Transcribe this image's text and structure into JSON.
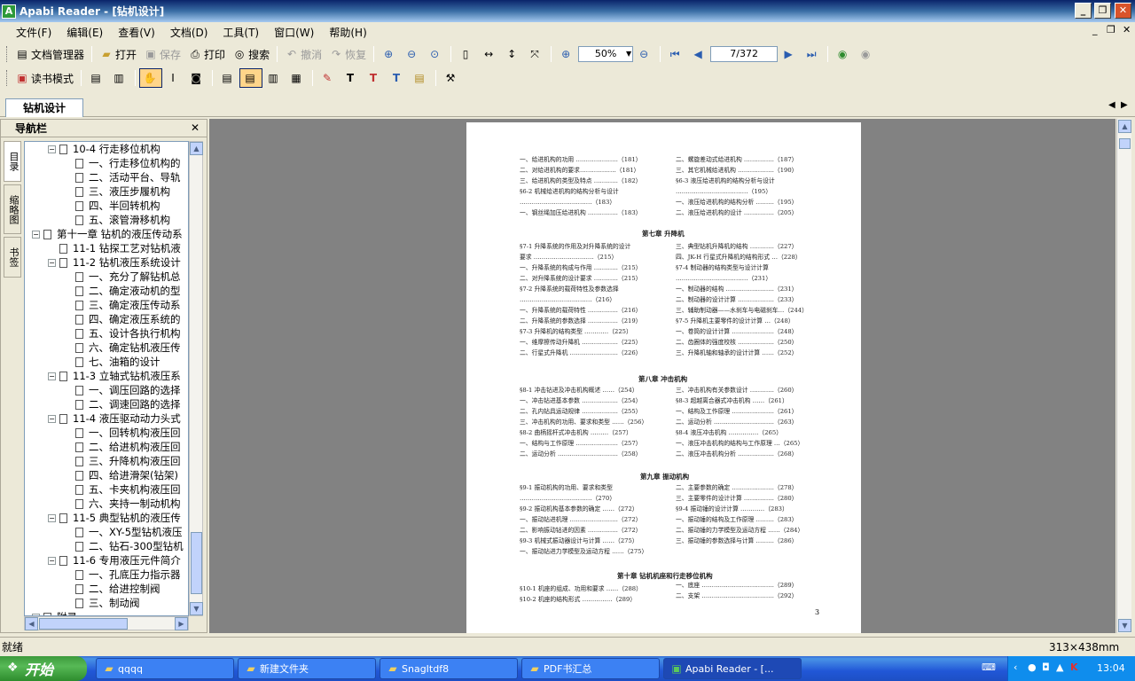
{
  "window": {
    "title": "Apabi Reader - [钻机设计]",
    "icon_text": "A"
  },
  "menus": [
    "文件(F)",
    "编辑(E)",
    "查看(V)",
    "文档(D)",
    "工具(T)",
    "窗口(W)",
    "帮助(H)"
  ],
  "toolbar1": {
    "doc_manager": "文档管理器",
    "open": "打开",
    "save": "保存",
    "print": "打印",
    "search": "搜索",
    "undo": "撤消",
    "redo": "恢复",
    "zoom_value": "50%",
    "page_value": "7/372"
  },
  "toolbar2": {
    "read_mode": "读书模式"
  },
  "doc_tab": "钻机设计",
  "nav": {
    "title": "导航栏",
    "tabs": [
      "目录",
      "缩略图",
      "书签"
    ],
    "tree": [
      {
        "text": "10-4 行走移位机构",
        "level": 2,
        "node": true
      },
      {
        "text": "一、行走移位机构的",
        "level": 3
      },
      {
        "text": "二、活动平台、导轨",
        "level": 3
      },
      {
        "text": "三、液压步履机构",
        "level": 3
      },
      {
        "text": "四、半回转机构",
        "level": 3
      },
      {
        "text": "五、滚管滑移机构",
        "level": 3
      },
      {
        "text": "第十一章 钻机的液压传动系",
        "level": 1,
        "node": true
      },
      {
        "text": "11-1 钻探工艺对钻机液",
        "level": 2
      },
      {
        "text": "11-2 钻机液压系统设计",
        "level": 2,
        "node": true
      },
      {
        "text": "一、充分了解钻机总",
        "level": 3
      },
      {
        "text": "二、确定液动机的型",
        "level": 3
      },
      {
        "text": "三、确定液压传动系",
        "level": 3
      },
      {
        "text": "四、确定液压系统的",
        "level": 3
      },
      {
        "text": "五、设计各执行机构",
        "level": 3
      },
      {
        "text": "六、确定钻机液压传",
        "level": 3
      },
      {
        "text": "七、油箱的设计",
        "level": 3
      },
      {
        "text": "11-3 立轴式钻机液压系",
        "level": 2,
        "node": true
      },
      {
        "text": "一、调压回路的选择",
        "level": 3
      },
      {
        "text": "二、调速回路的选择",
        "level": 3
      },
      {
        "text": "11-4 液压驱动动力头式",
        "level": 2,
        "node": true
      },
      {
        "text": "一、回转机构液压回",
        "level": 3
      },
      {
        "text": "二、给进机构液压回",
        "level": 3
      },
      {
        "text": "三、升降机构液压回",
        "level": 3
      },
      {
        "text": "四、给进滑架(钻架)",
        "level": 3
      },
      {
        "text": "五、卡夹机构液压回",
        "level": 3
      },
      {
        "text": "六、夹持一制动机构",
        "level": 3
      },
      {
        "text": "11-5 典型钻机的液压传",
        "level": 2,
        "node": true
      },
      {
        "text": "一、XY-5型钻机液压",
        "level": 3
      },
      {
        "text": "二、钻石-300型钻机",
        "level": 3
      },
      {
        "text": "11-6 专用液压元件简介",
        "level": 2,
        "node": true
      },
      {
        "text": "一、孔底压力指示器",
        "level": 3
      },
      {
        "text": "二、给进控制阀",
        "level": 3
      },
      {
        "text": "三、制动阀",
        "level": 3
      },
      {
        "text": "附录",
        "level": 1,
        "node": true
      }
    ]
  },
  "page": {
    "top_left": [
      "一、给进机构的功用 …………………（181）",
      "二、对给进机构的要求………………（181）",
      "三、给进机构的类型及特点 …………（182）",
      "§6-2 机械给进机构的结构分析与设计",
      "………………………………（183）",
      "一、钢丝绳加压给进机构 ……………（183）"
    ],
    "top_right": [
      "二、螺旋差动式给进机构 ……………（187）",
      "三、其它机械给进机构 ………………（190）",
      "§6-3 液压给进机构的结构分析与设计",
      "………………………………（195）",
      "一、液压给进机构的结构分析 ………（195）",
      "二、液压给进机构的设计 ……………（205）"
    ],
    "ch7_title": "第七章  升降机",
    "ch7_left": [
      "§7-1 升降系统的作用及对升降系统的设计",
      "要求 …………………………（215）",
      "一、升降系统的构成与作用 …………（215）",
      "二、对升降系统的设计要求 …………（215）",
      "§7-2 升降系统的载荷特性及参数选择",
      "………………………………（216）",
      "一、升降系统的载荷特性 ……………（216）",
      "二、升降系统的参数选择 ……………（219）",
      "§7-3 升降机的结构类型 …………（225）",
      "一、维摩擦传动升降机 ………………（225）",
      "二、行星式升降机 ……………………（226）"
    ],
    "ch7_right": [
      "三、典型钻机升降机的结构 …………（227）",
      "四、JK-H 行星式升降机的结构形式 …（228）",
      "§7-4 制动器的结构类型与设计计算",
      "………………………………（231）",
      "一、制动器的结构 ……………………（231）",
      "二、制动器的设计计算 ………………（233）",
      "三、辅助制动器——水刹车与电磁刹车…（244）",
      "§7-5 升降机主要零件的设计计算 …（248）",
      "一、卷筒的设计计算 …………………（248）",
      "二、齿圈体的强度校核 ………………（250）",
      "三、升降机轴和轴承的设计计算 ……（252）"
    ],
    "ch8_title": "第八章  冲击机构",
    "ch8_left": [
      "§8-1 冲击钻进及冲击机构概述 ……（254）",
      "一、冲击钻进基本参数 ………………（254）",
      "二、孔内钻具运动规律 ………………（255）",
      "三、冲击机构的功用、要求和类型 ……（256）",
      "§8-2 曲柄摇杆式冲击机构 ………（257）",
      "一、结构与工作原理 …………………（257）",
      "二、运动分析 …………………………（258）"
    ],
    "ch8_right": [
      "三、冲击机构有关参数设计 …………（260）",
      "§8-3 超越离合器式冲击机构 ……（261）",
      "一、结构及工作原理 …………………（261）",
      "二、运动分析 …………………………（263）",
      "§8-4 液压冲击机构 ……………（265）",
      "一、液压冲击机构的结构与工作原理 …（265）",
      "二、液压冲击机构分析 ………………（268）"
    ],
    "ch9_title": "第九章  振动机构",
    "ch9_left": [
      "§9-1 振动机构的功用、要求和类型",
      "………………………………（270）",
      "§9-2 振动机构基本参数的确定 ……（272）",
      "一、振动钻进机理 ……………………（272）",
      "二、影响振动钻进的因素 ……………（272）",
      "§9-3 机械式振动器设计与计算 ……（275）",
      "一、振动钻进力学模型及运动方程 ……（275）"
    ],
    "ch9_right": [
      "二、主要参数的确定 …………………（278）",
      "三、主要零件的设计计算 ……………（280）",
      "§9-4 振动锤的设计计算 …………（283）",
      "一、振动锤的结构及工作原理 ………（283）",
      "二、振动锤的力学模型及运动方程 ……（284）",
      "三、振动锤的参数选择与计算 ………（286）"
    ],
    "ch10_title": "第十章  钻机机座和行走移位机构",
    "ch10_left": [
      "§10-1 机座的组成、功用和要求 ……（288）",
      "§10-2 机座的结构形式 ……………（289）"
    ],
    "ch10_right": [
      "一、底座 ………………………………（289）",
      "二、支架 ………………………………（292）"
    ],
    "page_number": "3"
  },
  "status": {
    "left": "就绪",
    "right": "313×438mm"
  },
  "taskbar": {
    "start": "开始",
    "tasks": [
      "qqqq",
      "新建文件夹",
      "SnagItdf8",
      "PDF书汇总",
      "Apabi Reader - [..."
    ],
    "clock": "13:04"
  }
}
